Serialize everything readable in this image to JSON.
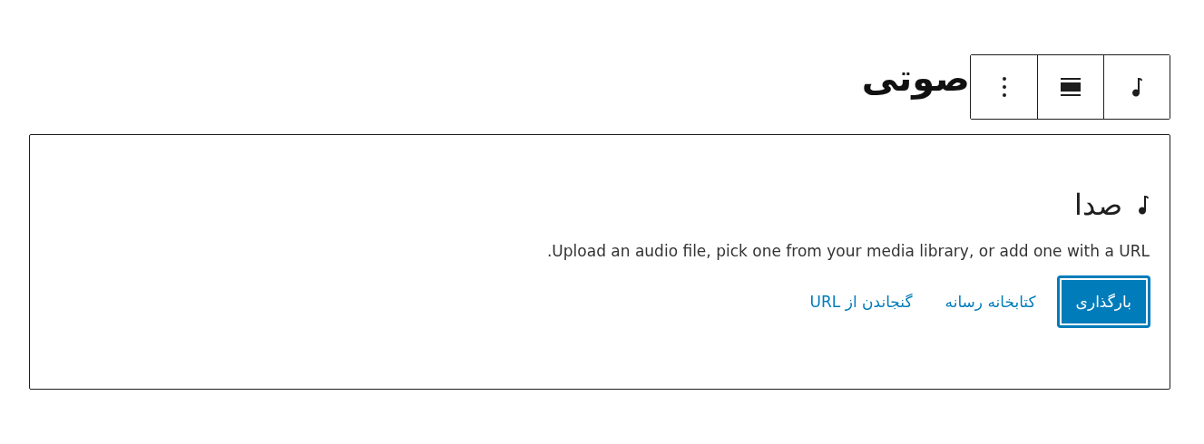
{
  "title": "صوتی",
  "toolbar": [
    {
      "kind": "audio"
    },
    {
      "kind": "align"
    },
    {
      "kind": "more"
    }
  ],
  "placeholder": {
    "label": "صدا",
    "instructions": "Upload an audio file, pick one from your media library, or add one with a URL.",
    "actions": [
      {
        "kind": "primary",
        "label": "بارگذاری"
      },
      {
        "kind": "link",
        "label": "کتابخانه رسانه"
      },
      {
        "kind": "link",
        "label": "گنجاندن از URL"
      }
    ]
  }
}
